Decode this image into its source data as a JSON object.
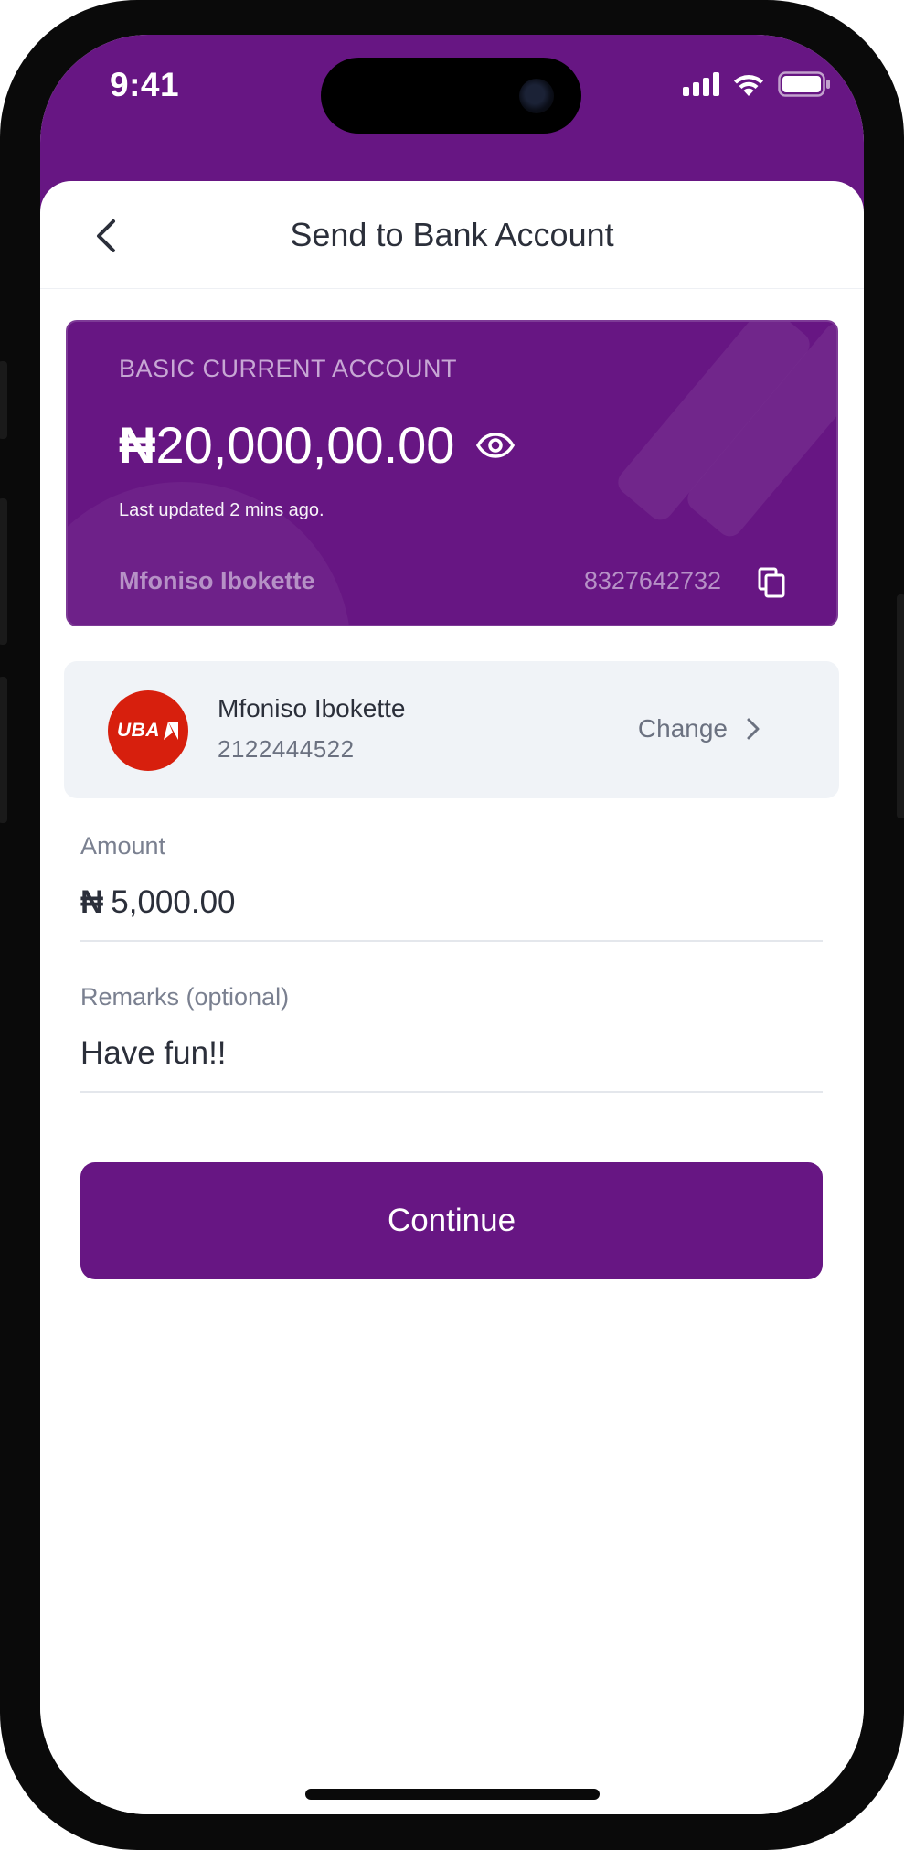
{
  "colors": {
    "brand_purple": "#671683",
    "bank_red": "#d71f0d",
    "text_dark": "#2b2f3a",
    "text_muted": "#6b7180"
  },
  "status_bar": {
    "time": "9:41",
    "icons": [
      "cellular-signal-icon",
      "wifi-icon",
      "battery-icon"
    ]
  },
  "nav": {
    "back_icon": "chevron-left-icon",
    "title": "Send to Bank Account"
  },
  "account_card": {
    "account_type": "BASIC CURRENT ACCOUNT",
    "currency_symbol": "₦",
    "balance": "20,000,00.00",
    "last_updated": "Last updated 2 mins ago.",
    "holder_name": "Mfoniso Ibokette",
    "account_number": "8327642732",
    "visibility_icon": "eye-icon",
    "copy_icon": "copy-icon"
  },
  "recipient": {
    "bank_logo_text": "UBA",
    "name": "Mfoniso Ibokette",
    "account_number": "2122444522",
    "change_label": "Change",
    "change_icon": "chevron-right-icon"
  },
  "amount_field": {
    "label": "Amount",
    "currency_symbol": "₦",
    "value": "5,000.00"
  },
  "remarks_field": {
    "label": "Remarks (optional)",
    "value": "Have fun!!"
  },
  "continue_button": {
    "label": "Continue"
  }
}
